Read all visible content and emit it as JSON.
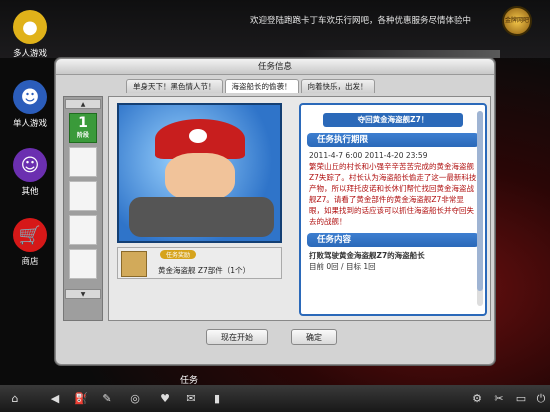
{
  "topbar": {
    "marquee": "欢迎登陆跑跑卡丁车欢乐行网吧，各种优惠服务尽情体验中",
    "badge": "金牌网吧"
  },
  "desktop": [
    {
      "label": "多人游戏",
      "icon": "pacman-icon",
      "color": "#e0b21a"
    },
    {
      "label": "单人游戏",
      "icon": "bear-icon",
      "color": "#2b5dbb"
    },
    {
      "label": "其他",
      "icon": "purple-character-icon",
      "color": "#6b2fb0"
    },
    {
      "label": "商店",
      "icon": "cart-icon",
      "color": "#d61818"
    }
  ],
  "window": {
    "title": "任务信息",
    "tabs": [
      "单身天下！黑色情人节！",
      "海盗船长的偷袭！",
      "向着快乐，出发！"
    ],
    "stage": {
      "label": "1",
      "sub": "阶段"
    },
    "part": {
      "tag": "任务奖励",
      "name": "黄金海盗舰 Z7部件（1个）"
    },
    "right": {
      "header": "夺回黄金海盗舰Z7！",
      "period_title": "任务执行期限",
      "start": "2011-4-7  6:00   2011-4-20 23:59",
      "desc_red": "繁荣山丘的村长和小强辛辛苦苦完成的黄金海盗舰Z7失踪了。村长认为海盗船长偷走了这一最新科技产物，所以拜托皮诺和长休们帮忙找回黄金海盗战舰Z7。请看了黄金部件的黄金海盗舰Z7非常显眼，如果找到的话应该可以抓住海盗船长并夺回失去的战舰！",
      "content_title": "任务内容",
      "task": "打败驾驶黄金海盗舰Z7的海盗船长",
      "progress": "目前 0回 / 目标 1回"
    },
    "buttons": {
      "start": "现在开始",
      "ok": "确定"
    }
  },
  "taskbar": {
    "label": "任务"
  }
}
